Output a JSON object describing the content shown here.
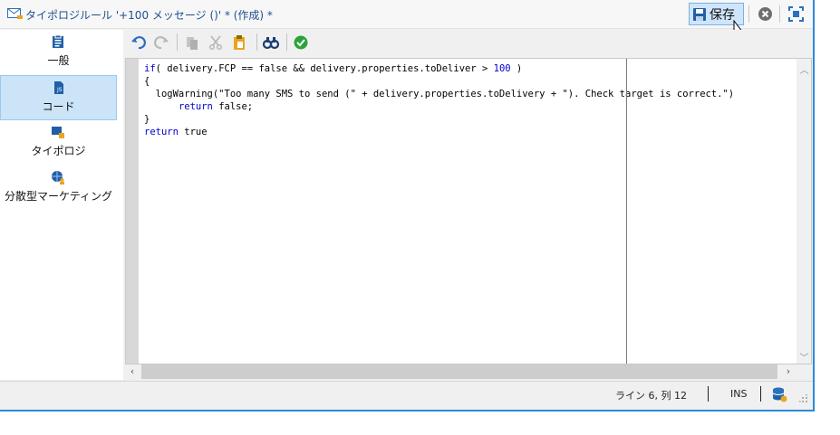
{
  "window": {
    "title": "タイポロジルール '+100 メッセージ ()' * (作成) *",
    "save_label": "保存",
    "accent": "#2a8bd8"
  },
  "sidebar": {
    "items": [
      {
        "label": "一般",
        "icon": "clipboard-icon",
        "active": false
      },
      {
        "label": "コード",
        "icon": "code-file-icon",
        "active": true
      },
      {
        "label": "タイポロジ",
        "icon": "typology-icon",
        "active": false
      },
      {
        "label": "分散型マーケティング",
        "icon": "globe-user-icon",
        "active": false
      }
    ]
  },
  "toolbar": {
    "tools": [
      "undo-icon",
      "redo-icon",
      "copy-icon",
      "cut-icon",
      "paste-icon",
      "find-icon",
      "check-icon"
    ]
  },
  "editor": {
    "lines": [
      "if( delivery.FCP == false && delivery.properties.toDeliver > 100 )",
      "{",
      "  logWarning(\"Too many SMS to send (\" + delivery.properties.toDelivery + \"). Check target is correct.\")",
      "      return false;",
      "}",
      "return true"
    ]
  },
  "status": {
    "position": "ライン 6, 列 12",
    "mode": "INS"
  }
}
